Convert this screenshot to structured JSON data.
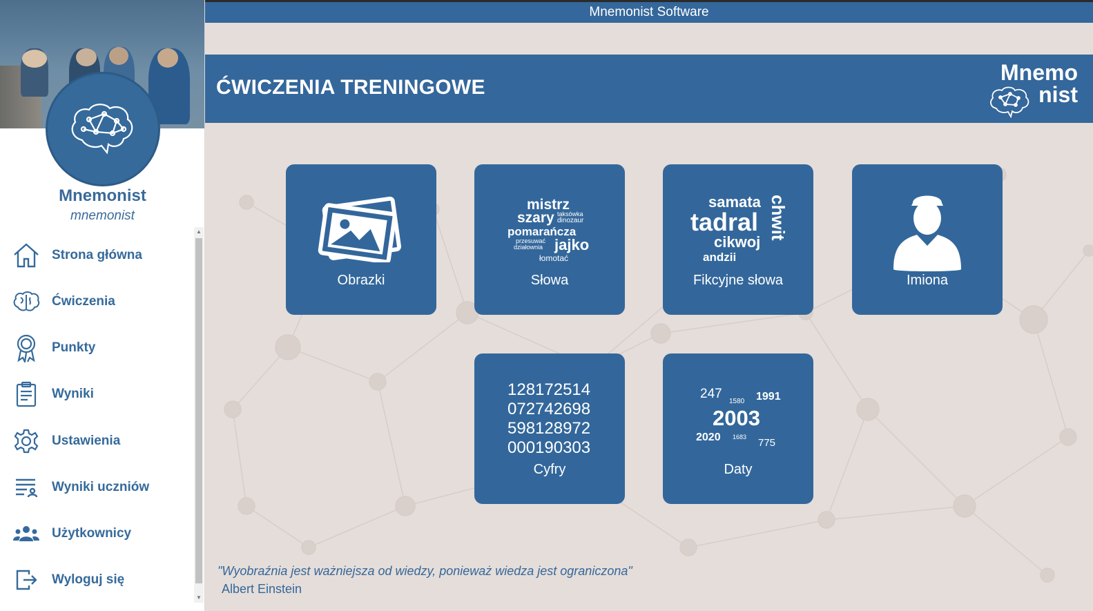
{
  "app": {
    "title": "Mnemonist Software"
  },
  "user": {
    "display_name": "Mnemonist",
    "login": "mnemonist"
  },
  "nav": [
    {
      "label": "Strona główna",
      "icon": "home-icon"
    },
    {
      "label": "Ćwiczenia",
      "icon": "brain-icon"
    },
    {
      "label": "Punkty",
      "icon": "award-icon"
    },
    {
      "label": "Wyniki",
      "icon": "clipboard-icon"
    },
    {
      "label": "Ustawienia",
      "icon": "gear-icon"
    },
    {
      "label": "Wyniki uczniów",
      "icon": "list-user-icon"
    },
    {
      "label": "Użytkownicy",
      "icon": "users-icon"
    },
    {
      "label": "Wyloguj się",
      "icon": "logout-icon"
    }
  ],
  "page": {
    "title": "ĆWICZENIA TRENINGOWE",
    "logo_top": "Mnemo",
    "logo_bottom": "nist"
  },
  "tiles": [
    {
      "label": "Obrazki",
      "icon": "images-icon"
    },
    {
      "label": "Słowa",
      "icon": "word-cloud-icon"
    },
    {
      "label": "Fikcyjne słowa",
      "icon": "fictional-word-cloud-icon"
    },
    {
      "label": "Imiona",
      "icon": "person-icon"
    },
    {
      "label": "Cyfry",
      "icon": "digits-icon"
    },
    {
      "label": "Daty",
      "icon": "dates-icon"
    }
  ],
  "words_cloud": [
    "mistrz",
    "szary",
    "taksówka",
    "dinozaur",
    "pomarańcza",
    "przesuwać",
    "działownia",
    "jajko",
    "łomotać"
  ],
  "fictional_cloud": [
    "samata",
    "tadral",
    "chwit",
    "cikwoj",
    "andzii"
  ],
  "digits": [
    "128172514",
    "072742698",
    "598128972",
    "000190303"
  ],
  "dates_cloud": [
    "247",
    "1580",
    "1991",
    "2003",
    "2020",
    "1683",
    "775"
  ],
  "quote": {
    "text": "\"Wyobraźnia jest ważniejsza od wiedzy, ponieważ wiedza jest ograniczona\"",
    "author": "Albert Einstein"
  },
  "colors": {
    "primary": "#34679b",
    "background": "#e5ddd9",
    "sidebar": "#ffffff"
  }
}
